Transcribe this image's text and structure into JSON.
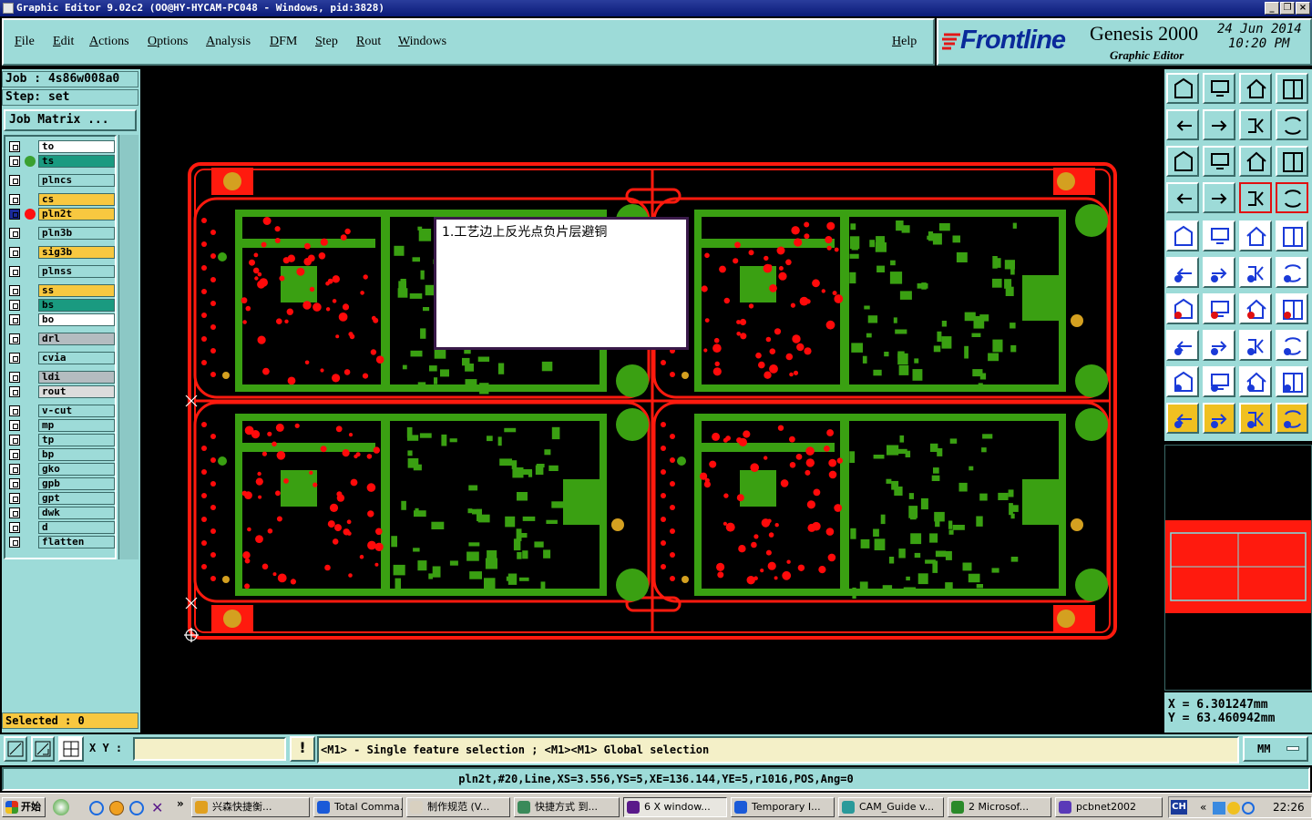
{
  "window": {
    "title": "Graphic Editor 9.02c2 (OO@HY-HYCAM-PC048 - Windows, pid:3828)"
  },
  "menu": {
    "file": "File",
    "edit": "Edit",
    "actions": "Actions",
    "options": "Options",
    "analysis": "Analysis",
    "dfm": "DFM",
    "step": "Step",
    "rout": "Rout",
    "windows": "Windows",
    "help": "Help"
  },
  "brand": {
    "logo": "Frontline",
    "product": "Genesis 2000",
    "subtitle": "Graphic Editor",
    "date": "24 Jun 2014",
    "time": "10:20 PM"
  },
  "job": {
    "job_label": "Job : 4s86w008a0",
    "step_label": "Step: set",
    "matrix_button": "Job Matrix ..."
  },
  "layers": [
    {
      "name": "to",
      "color": "#ffffff",
      "dot": ""
    },
    {
      "name": "ts",
      "color": "#1a9a80",
      "dot": "#3aa030"
    },
    {
      "name": "plncs",
      "color": "#9ddbd8",
      "dot": ""
    },
    {
      "name": "cs",
      "color": "#f8c840",
      "dot": ""
    },
    {
      "name": "pln2t",
      "color": "#f8c840",
      "dot": "#ff1010"
    },
    {
      "name": "pln3b",
      "color": "#9ddbd8",
      "dot": ""
    },
    {
      "name": "sig3b",
      "color": "#f8c840",
      "dot": ""
    },
    {
      "name": "plnss",
      "color": "#9ddbd8",
      "dot": ""
    },
    {
      "name": "ss",
      "color": "#f8c840",
      "dot": ""
    },
    {
      "name": "bs",
      "color": "#1a9a80",
      "dot": ""
    },
    {
      "name": "bo",
      "color": "#ffffff",
      "dot": ""
    },
    {
      "name": "drl",
      "color": "#b4bcc0",
      "dot": ""
    },
    {
      "name": "cvia",
      "color": "#9ddbd8",
      "dot": ""
    },
    {
      "name": "ldi",
      "color": "#b4bcc0",
      "dot": ""
    },
    {
      "name": "rout",
      "color": "#dcdcdc",
      "dot": ""
    },
    {
      "name": "v-cut",
      "color": "#9ddbd8",
      "dot": ""
    },
    {
      "name": "mp",
      "color": "#9ddbd8",
      "dot": ""
    },
    {
      "name": "tp",
      "color": "#9ddbd8",
      "dot": ""
    },
    {
      "name": "bp",
      "color": "#9ddbd8",
      "dot": ""
    },
    {
      "name": "gko",
      "color": "#9ddbd8",
      "dot": ""
    },
    {
      "name": "gpb",
      "color": "#9ddbd8",
      "dot": ""
    },
    {
      "name": "gpt",
      "color": "#9ddbd8",
      "dot": ""
    },
    {
      "name": "dwk",
      "color": "#9ddbd8",
      "dot": ""
    },
    {
      "name": "d",
      "color": "#9ddbd8",
      "dot": ""
    },
    {
      "name": "flatten",
      "color": "#9ddbd8",
      "dot": ""
    }
  ],
  "selected": {
    "label": "Selected : 0"
  },
  "popup": {
    "text": "1.工艺边上反光点负片层避铜"
  },
  "coords": {
    "x": "X  =  6.301247mm",
    "y": "Y  =  63.460942mm"
  },
  "bottom": {
    "xy_label": "X Y :",
    "xy_value": "",
    "hint": "<M1> - Single feature selection ; <M1><M1> Global selection",
    "units": "MM",
    "warn": "!"
  },
  "status": {
    "text": "pln2t,#20,Line,XS=3.556,YS=5,XE=136.144,YE=5,r1016,POS,Ang=0"
  },
  "taskbar": {
    "start": "开始",
    "tasks": [
      "兴森快捷衡...",
      "Total Comma...",
      "制作规范 (V...",
      "快捷方式 到...",
      "6 X window...",
      "Temporary I...",
      "CAM_Guide v...",
      "2 Microsof...",
      "pcbnet2002"
    ],
    "lang": "CH",
    "clock": "22:26"
  },
  "colors": {
    "panel": "#9ddbd8",
    "copper": "#ff1a0e",
    "green": "#3aa012",
    "pad": "#ff0a0a"
  }
}
